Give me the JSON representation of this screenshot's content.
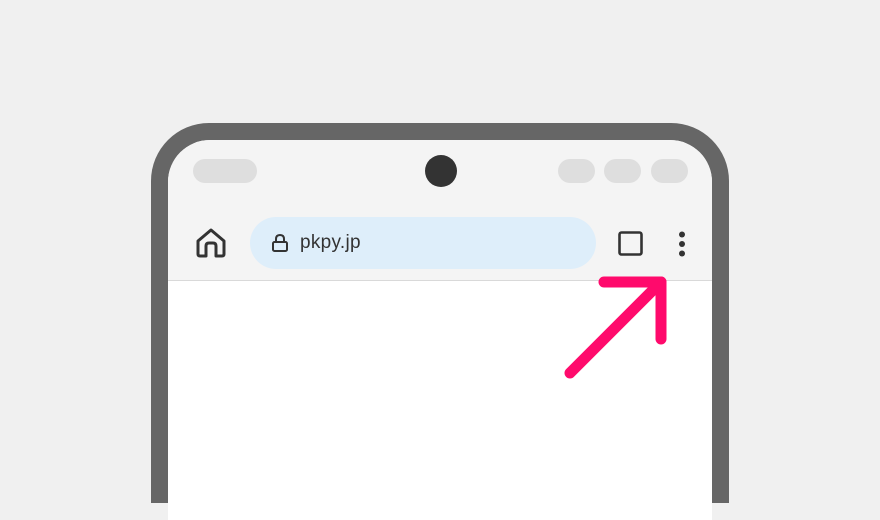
{
  "browser": {
    "url": "pkpy.jp"
  },
  "icons": {
    "home": "home-icon",
    "lock": "lock-icon",
    "tabs": "tabs-icon",
    "menu": "more-vert-icon",
    "annotation": "pointer-arrow-icon"
  },
  "colors": {
    "background": "#f0f0f0",
    "frame": "#666666",
    "toolbar": "#f4f4f4",
    "url_bar": "#deeefa",
    "arrow": "#ff0a6c"
  }
}
